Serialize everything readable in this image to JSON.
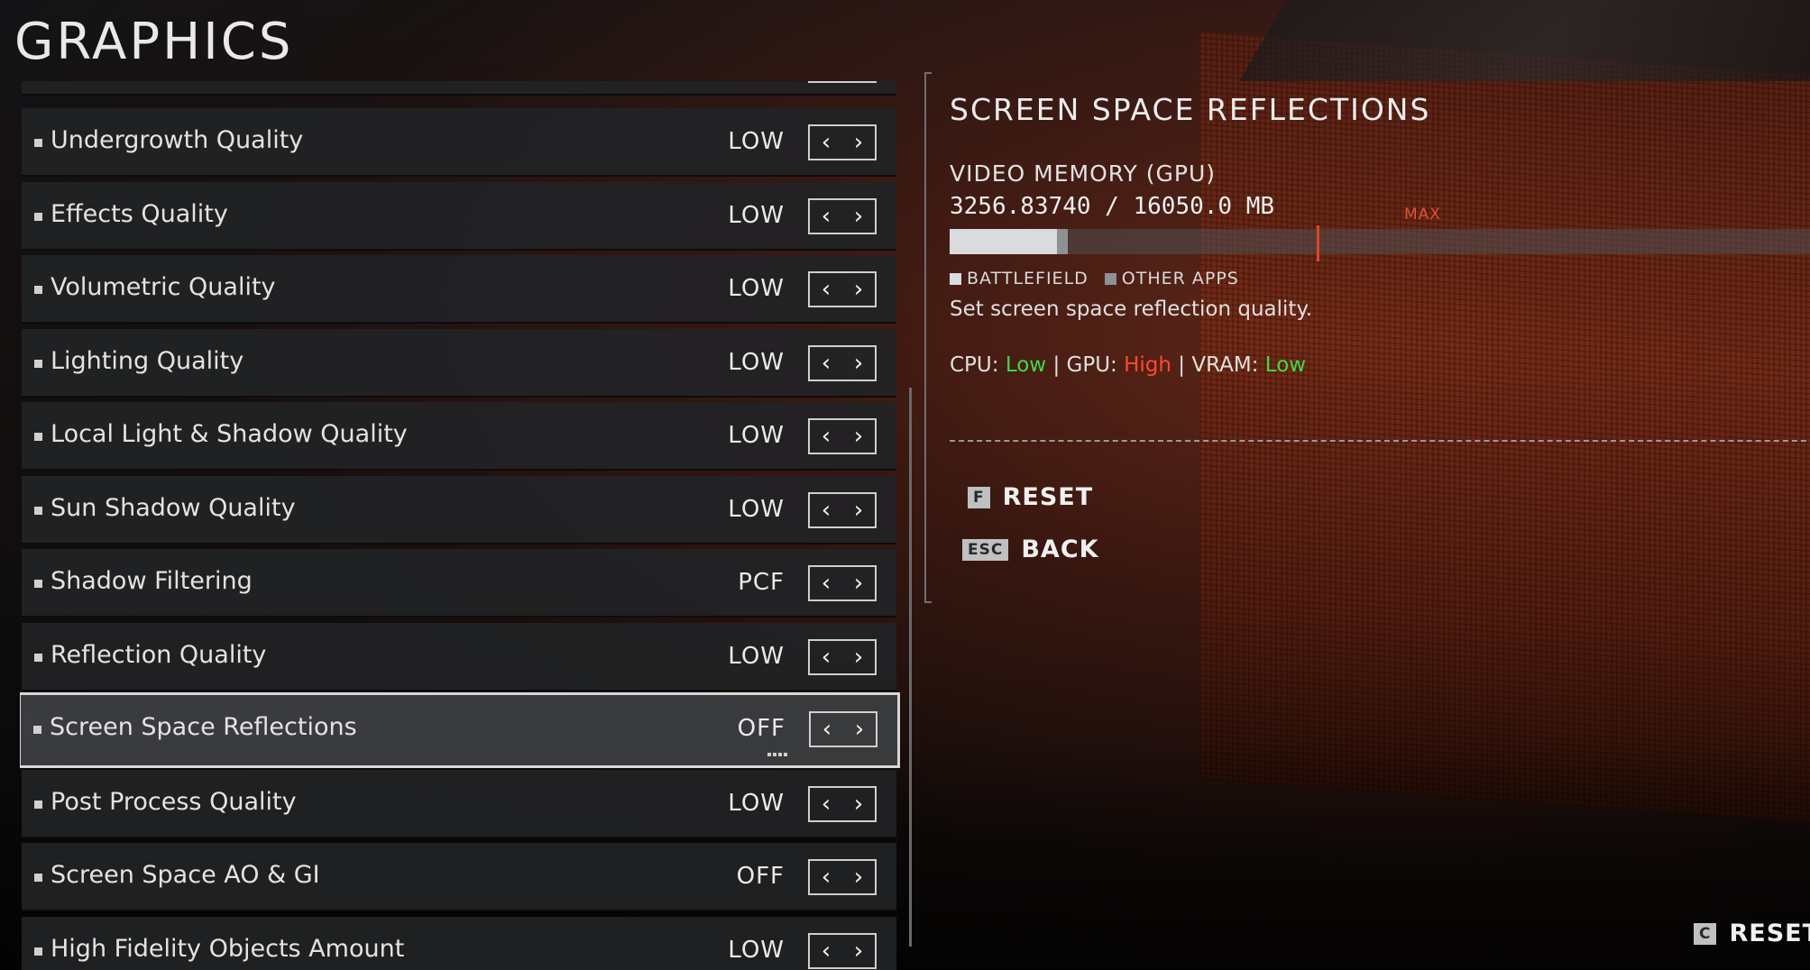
{
  "page": {
    "title": "GRAPHICS"
  },
  "settings": [
    {
      "label": "Undergrowth Quality",
      "value": "LOW"
    },
    {
      "label": "Effects Quality",
      "value": "LOW"
    },
    {
      "label": "Volumetric Quality",
      "value": "LOW"
    },
    {
      "label": "Lighting Quality",
      "value": "LOW"
    },
    {
      "label": "Local Light & Shadow Quality",
      "value": "LOW"
    },
    {
      "label": "Sun Shadow Quality",
      "value": "LOW"
    },
    {
      "label": "Shadow Filtering",
      "value": "PCF"
    },
    {
      "label": "Reflection Quality",
      "value": "LOW"
    },
    {
      "label": "Screen Space Reflections",
      "value": "OFF",
      "selected": true
    },
    {
      "label": "Post Process Quality",
      "value": "LOW"
    },
    {
      "label": "Screen Space AO & GI",
      "value": "OFF"
    },
    {
      "label": "High Fidelity Objects Amount",
      "value": "LOW"
    }
  ],
  "stepper": {
    "prev_glyph": "‹",
    "next_glyph": "›"
  },
  "info": {
    "title": "SCREEN SPACE REFLECTIONS",
    "vram_label": "VIDEO MEMORY (GPU)",
    "vram_value": "3256.83740 / 16050.0 MB",
    "vram_used_mb": 3256.8374,
    "vram_total_mb": 16050.0,
    "vram_other_fraction": 0.012,
    "vram_max_fraction": 0.415,
    "max_label": "MAX",
    "legend_battlefield": "BATTLEFIELD",
    "legend_other": "OTHER APPS",
    "description": "Set screen space reflection quality.",
    "impact": {
      "cpu_label": "CPU:",
      "cpu_value": "Low",
      "gpu_label": "GPU:",
      "gpu_value": "High",
      "vram_label": "VRAM:",
      "vram_value": "Low",
      "separator": "|"
    }
  },
  "actions": {
    "reset_key": "F",
    "reset_label": "RESET",
    "back_key": "ESC",
    "back_label": "BACK",
    "corner_reset_key": "C",
    "corner_reset_label": "RESET"
  },
  "colors": {
    "low": "#3fd94a",
    "high": "#ff4a2e",
    "max_marker": "#e0442a",
    "bar_battlefield": "#d9dbde",
    "bar_other": "#8e9094"
  }
}
